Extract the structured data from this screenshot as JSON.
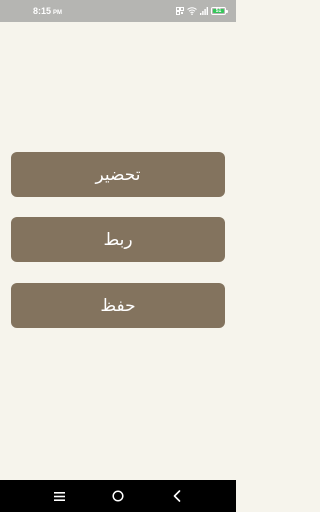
{
  "status_bar": {
    "time": "8:15",
    "ampm": "PM",
    "battery_level": "51"
  },
  "menu": {
    "buttons": [
      {
        "label": "تحضير"
      },
      {
        "label": "ربط"
      },
      {
        "label": "حفظ"
      }
    ]
  },
  "nav_bar": {
    "icons": [
      "recent-apps-icon",
      "home-icon",
      "back-icon"
    ]
  },
  "colors": {
    "background": "#f6f4ec",
    "button": "#83735e",
    "status_bar": "#b5b5b2",
    "nav_bar": "#000000"
  }
}
